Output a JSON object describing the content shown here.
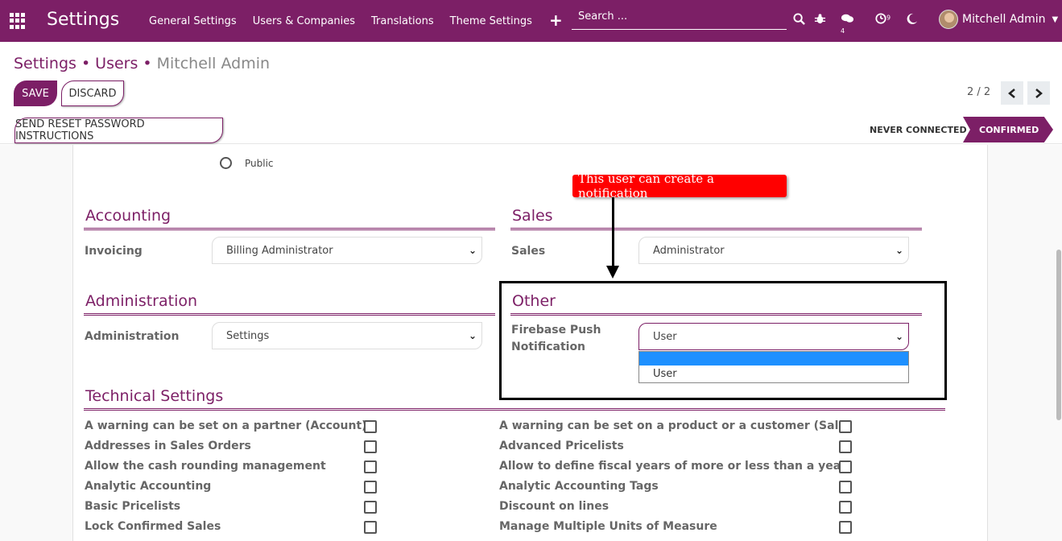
{
  "navbar": {
    "app_name": "Settings",
    "menu": [
      "General Settings",
      "Users & Companies",
      "Translations",
      "Theme Settings"
    ],
    "search_placeholder": "Search ...",
    "chat_count": "4",
    "activity_count": "9",
    "user_name": "Mitchell Admin"
  },
  "breadcrumb": {
    "items": [
      "Settings",
      "Users"
    ],
    "current": "Mitchell Admin",
    "separator": "•"
  },
  "buttons": {
    "save": "SAVE",
    "discard": "DISCARD",
    "reset_password": "SEND RESET PASSWORD INSTRUCTIONS"
  },
  "pager": {
    "text": "2 / 2"
  },
  "status": {
    "never_connected": "NEVER CONNECTED",
    "confirmed": "CONFIRMED"
  },
  "user_type": {
    "public_label": "Public"
  },
  "accounting": {
    "title": "Accounting",
    "invoicing_label": "Invoicing",
    "invoicing_value": "Billing Administrator"
  },
  "sales": {
    "title": "Sales",
    "sales_label": "Sales",
    "sales_value": "Administrator"
  },
  "administration": {
    "title": "Administration",
    "admin_label": "Administration",
    "admin_value": "Settings"
  },
  "other": {
    "title": "Other",
    "firebase_label_line1": "Firebase Push",
    "firebase_label_line2": "Notification",
    "firebase_value": "User",
    "dropdown_options": [
      "",
      "User"
    ]
  },
  "annotation": {
    "callout_text": "This user can create a notification"
  },
  "technical": {
    "title": "Technical Settings",
    "left": [
      "A warning can be set on a partner (Account)",
      "Addresses in Sales Orders",
      "Allow the cash rounding management",
      "Analytic Accounting",
      "Basic Pricelists",
      "Lock Confirmed Sales"
    ],
    "right": [
      "A warning can be set on a product or a customer (Sale)",
      "Advanced Pricelists",
      "Allow to define fiscal years of more or less than a year",
      "Analytic Accounting Tags",
      "Discount on lines",
      "Manage Multiple Units of Measure"
    ]
  },
  "colors": {
    "brand": "#7c1f66",
    "callout": "#ff0000",
    "dropdown_highlight": "#1e90ff"
  }
}
